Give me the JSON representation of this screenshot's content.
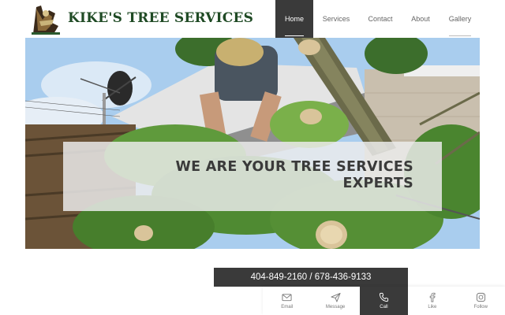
{
  "header": {
    "brand": "KIKE'S TREE SERVICES",
    "logo_icon": "tree-worker-logo"
  },
  "nav": {
    "items": [
      {
        "label": "Home",
        "active": true
      },
      {
        "label": "Services",
        "active": false
      },
      {
        "label": "Contact",
        "active": false
      },
      {
        "label": "About",
        "active": false
      },
      {
        "label": "Gallery",
        "active": false
      }
    ]
  },
  "hero": {
    "title_line1": "WE ARE YOUR TREE SERVICES",
    "title_line2": "EXPERTS"
  },
  "phone": {
    "text": "404-849-2160 / 678-436-9133"
  },
  "actions": {
    "items": [
      {
        "label": "Email",
        "icon": "mail-icon",
        "active": false
      },
      {
        "label": "Message",
        "icon": "send-icon",
        "active": false
      },
      {
        "label": "Call",
        "icon": "phone-icon",
        "active": true
      },
      {
        "label": "Like",
        "icon": "facebook-icon",
        "active": false
      },
      {
        "label": "Follow",
        "icon": "instagram-icon",
        "active": false
      }
    ]
  },
  "colors": {
    "brand_green": "#1f4a24",
    "dark_bar": "#3a3a3a",
    "nav_text": "#666666"
  }
}
